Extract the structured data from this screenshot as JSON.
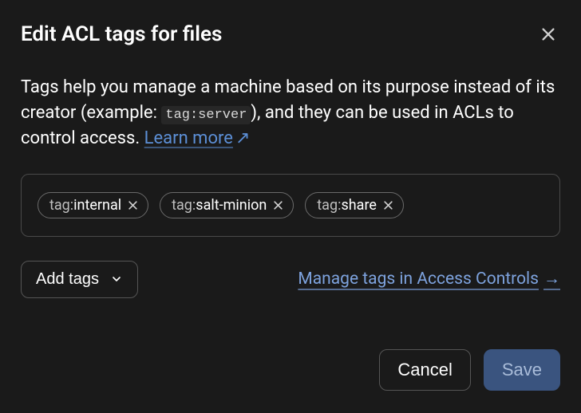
{
  "dialog": {
    "title": "Edit ACL tags for files",
    "description_part1": "Tags help you manage a machine based on its purpose instead of its creator (example: ",
    "description_code": "tag:server",
    "description_part2": "), and they can be used in ACLs to control access. ",
    "learn_more_label": "Learn more",
    "learn_more_arrow": "↗"
  },
  "tags": [
    {
      "prefix": "tag:",
      "name": "internal"
    },
    {
      "prefix": "tag:",
      "name": "salt-minion"
    },
    {
      "prefix": "tag:",
      "name": "share"
    }
  ],
  "actions": {
    "add_tags_label": "Add tags",
    "manage_link_label": "Manage tags in Access Controls",
    "manage_link_arrow": "→"
  },
  "footer": {
    "cancel_label": "Cancel",
    "save_label": "Save"
  }
}
